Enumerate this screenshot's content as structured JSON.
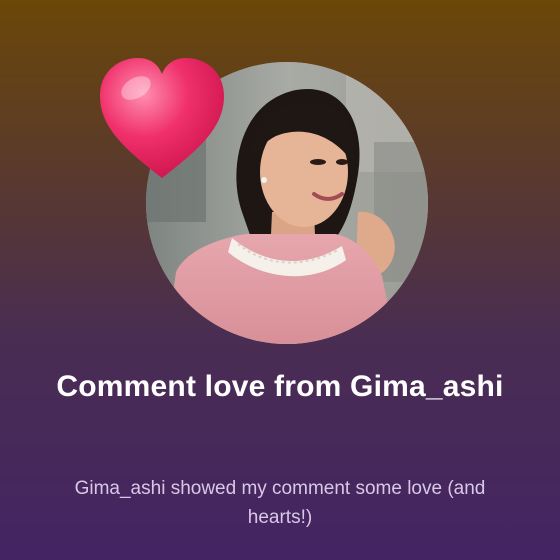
{
  "notification": {
    "title": "Comment love from Gima_ashi",
    "message": "Gima_ashi showed my comment some love (and hearts!)"
  },
  "icons": {
    "heart": "heart-icon",
    "avatar": "profile-photo"
  },
  "colors": {
    "background_top": "#6b4708",
    "background_bottom": "#442463",
    "heart": "#f0306a",
    "title_text": "#ffffff",
    "message_text": "#d9c8e6"
  }
}
